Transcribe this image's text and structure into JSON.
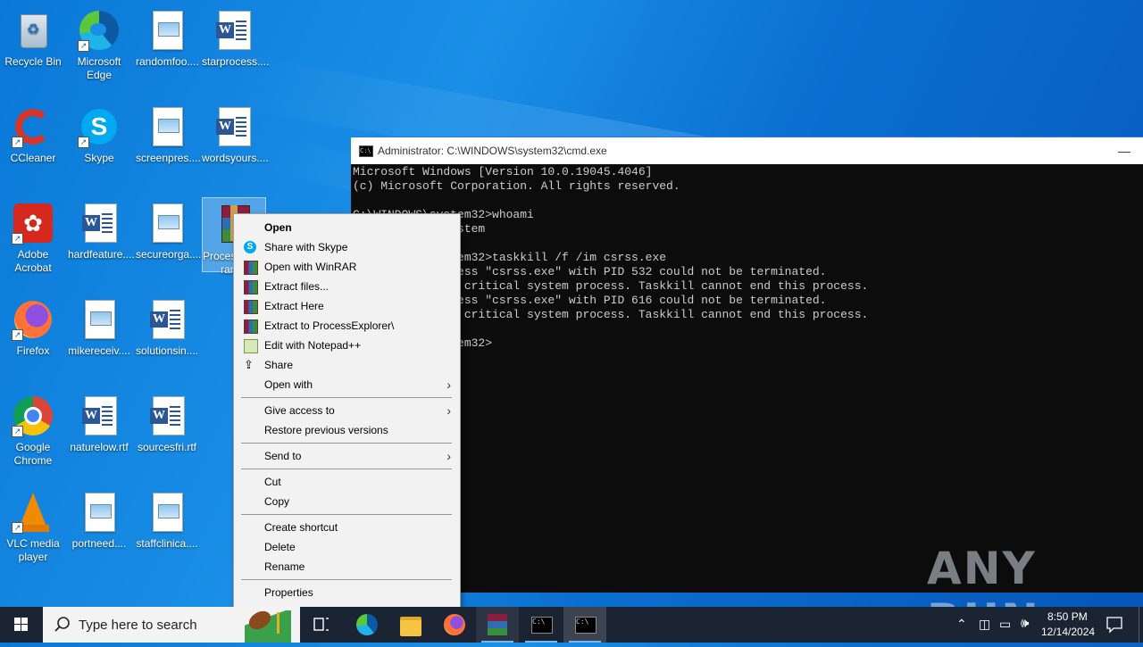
{
  "desktop": {
    "icons": [
      {
        "label": "Recycle Bin",
        "icon": "recycle-bin-icon"
      },
      {
        "label": "Microsoft Edge",
        "icon": "edge-icon"
      },
      {
        "label": "randomfoo....",
        "icon": "image-file-icon"
      },
      {
        "label": "starprocess....",
        "icon": "word-document-icon"
      },
      {
        "label": "CCleaner",
        "icon": "ccleaner-icon"
      },
      {
        "label": "Skype",
        "icon": "skype-icon"
      },
      {
        "label": "screenpres....",
        "icon": "image-file-icon"
      },
      {
        "label": "wordsyours....",
        "icon": "word-document-icon"
      },
      {
        "label": "Adobe Acrobat",
        "icon": "acrobat-icon"
      },
      {
        "label": "hardfeature....",
        "icon": "word-document-icon"
      },
      {
        "label": "secureorga....",
        "icon": "image-file-icon"
      },
      {
        "label": "ProcessExplorer.rar",
        "icon": "winrar-archive-icon"
      },
      {
        "label": "Firefox",
        "icon": "firefox-icon"
      },
      {
        "label": "mikereceiv....",
        "icon": "image-file-icon"
      },
      {
        "label": "solutionsin....",
        "icon": "word-document-icon"
      },
      {
        "label": "Google Chrome",
        "icon": "chrome-icon"
      },
      {
        "label": "naturelow.rtf",
        "icon": "word-document-icon"
      },
      {
        "label": "sourcesfri.rtf",
        "icon": "word-document-icon"
      },
      {
        "label": "VLC media player",
        "icon": "vlc-icon"
      },
      {
        "label": "portneed....",
        "icon": "image-file-icon"
      },
      {
        "label": "staffclinica....",
        "icon": "image-file-icon"
      }
    ],
    "selected_partial_label_line1": "Proces",
    "selected_partial_label_line2": "rar"
  },
  "cmd": {
    "title": "Administrator: C:\\WINDOWS\\system32\\cmd.exe",
    "lines": [
      "Microsoft Windows [Version 10.0.19045.4046]",
      "(c) Microsoft Corporation. All rights reserved.",
      "",
      "C:\\WINDOWS\\system32>whoami",
      "nt authority\\system",
      "",
      "C:\\WINDOWS\\system32>taskkill /f /im csrss.exe",
      "ERROR: The process \"csrss.exe\" with PID 532 could not be terminated.",
      "Reason: This is critical system process. Taskkill cannot end this process.",
      "ERROR: The process \"csrss.exe\" with PID 616 could not be terminated.",
      "Reason: This is critical system process. Taskkill cannot end this process.",
      "",
      "C:\\WINDOWS\\system32>"
    ]
  },
  "context_menu": {
    "items": [
      {
        "label": "Open",
        "bold": true,
        "icon": ""
      },
      {
        "label": "Share with Skype",
        "icon": "skype-icon"
      },
      {
        "label": "Open with WinRAR",
        "icon": "winrar-icon"
      },
      {
        "label": "Extract files...",
        "icon": "winrar-icon"
      },
      {
        "label": "Extract Here",
        "icon": "winrar-icon"
      },
      {
        "label": "Extract to ProcessExplorer\\",
        "icon": "winrar-icon"
      },
      {
        "label": "Edit with Notepad++",
        "icon": "notepadpp-icon"
      },
      {
        "label": "Share",
        "icon": "share-icon"
      },
      {
        "label": "Open with",
        "submenu": true
      },
      {
        "label": "Give access to",
        "submenu": true
      },
      {
        "label": "Restore previous versions"
      },
      {
        "label": "Send to",
        "submenu": true
      },
      {
        "label": "Cut"
      },
      {
        "label": "Copy"
      },
      {
        "label": "Create shortcut"
      },
      {
        "label": "Delete"
      },
      {
        "label": "Rename"
      },
      {
        "label": "Properties"
      }
    ]
  },
  "watermark": "ANY RUN",
  "taskbar": {
    "search_placeholder": "Type here to search",
    "time": "8:50 PM",
    "date": "12/14/2024"
  }
}
